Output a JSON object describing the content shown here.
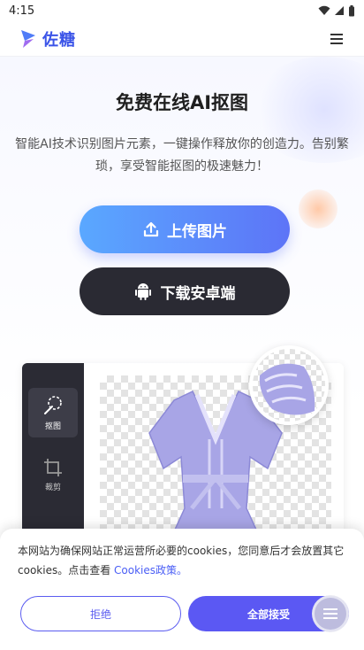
{
  "status_bar": {
    "time": "4:15"
  },
  "header": {
    "brand_name": "佐糖",
    "menu_icon": "hamburger-menu-icon"
  },
  "hero": {
    "title": "免费在线AI抠图",
    "subtitle": "智能AI技术识别图片元素，一键操作释放你的创造力。告别繁琐，享受智能抠图的极速魅力！",
    "upload_label": "上传图片",
    "download_label": "下载安卓端"
  },
  "editor": {
    "tools": [
      {
        "label": "抠图",
        "icon": "magic-wand-icon"
      },
      {
        "label": "裁剪",
        "icon": "crop-icon"
      }
    ]
  },
  "cookie": {
    "text": "本网站为确保网站正常运营所必要的cookies，您同意后才会放置其它cookies。点击查看",
    "link": "Cookies政策。",
    "reject_label": "拒绝",
    "accept_label": "全部接受"
  },
  "colors": {
    "brand": "#3b54e8",
    "accent": "#5b58f3",
    "dark_button": "#2a2a33"
  }
}
